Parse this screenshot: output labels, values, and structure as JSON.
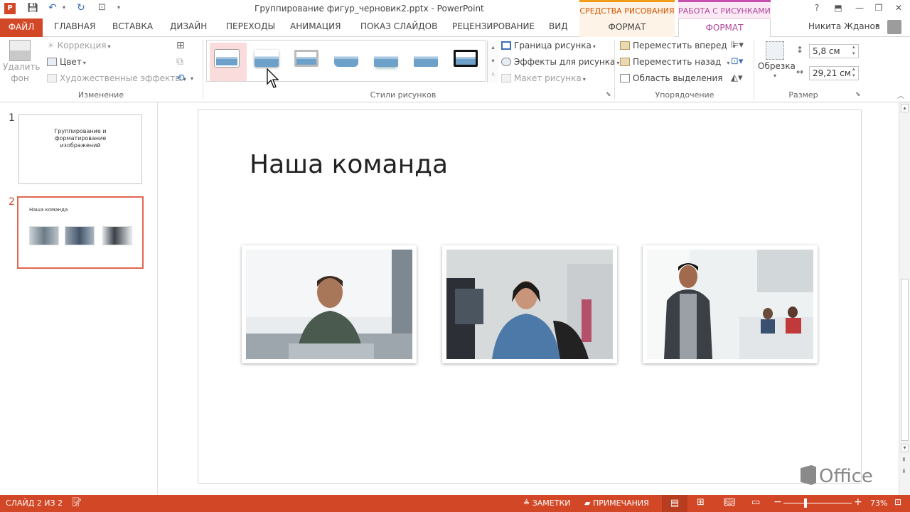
{
  "titlebar": {
    "title": "Группирование фигур_черновик2.pptx - PowerPoint",
    "context_drawing": "СРЕДСТВА РИСОВАНИЯ",
    "context_picture": "РАБОТА С РИСУНКАМИ",
    "help": "?",
    "minimize": "—",
    "restore": "❐",
    "close": "✕"
  },
  "tabs": {
    "file": "ФАЙЛ",
    "home": "ГЛАВНАЯ",
    "insert": "ВСТАВКА",
    "design": "ДИЗАЙН",
    "transitions": "ПЕРЕХОДЫ",
    "animations": "АНИМАЦИЯ",
    "slideshow": "ПОКАЗ СЛАЙДОВ",
    "review": "РЕЦЕНЗИРОВАНИЕ",
    "view": "ВИД",
    "format_draw": "ФОРМАТ",
    "format_pic": "ФОРМАТ",
    "user": "Никита Жданов"
  },
  "ribbon": {
    "remove_bg": "Удалить фон",
    "correction": "Коррекция",
    "color": "Цвет",
    "artistic": "Художественные эффекты",
    "group_change": "Изменение",
    "group_styles": "Стили рисунков",
    "border": "Граница рисунка",
    "effects": "Эффекты для рисунка",
    "layout": "Макет рисунка",
    "bring_forward": "Переместить вперед",
    "send_backward": "Переместить назад",
    "selection_pane": "Область выделения",
    "group_arrange": "Упорядочение",
    "crop": "Обрезка",
    "height": "5,8 см",
    "width": "29,21 см",
    "group_size": "Размер"
  },
  "slides": {
    "thumb1_num": "1",
    "thumb1_text": "Группирование и форматирование изображений",
    "thumb2_num": "2",
    "thumb2_text": "Наша команда"
  },
  "slide": {
    "title": "Наша команда"
  },
  "status": {
    "slide": "СЛАЙД 2 ИЗ 2",
    "notes": "ЗАМЕТКИ",
    "comments": "ПРИМЕЧАНИЯ",
    "zoom": "73%"
  },
  "office_logo": "Office",
  "colors": {
    "accent": "#d24726",
    "picture_context": "#b4459b",
    "drawing_context": "#f29b1b"
  }
}
